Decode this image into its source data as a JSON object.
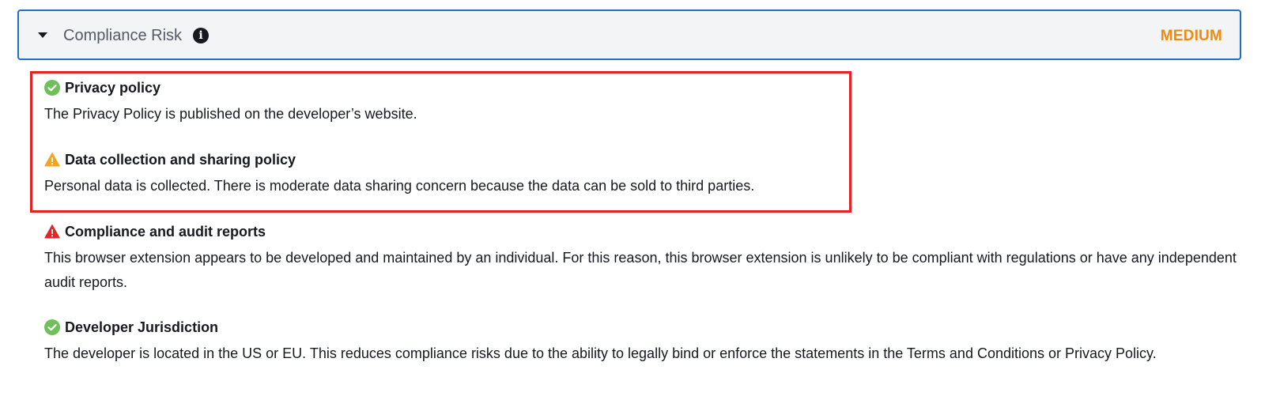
{
  "panel": {
    "title": "Compliance Risk",
    "info_icon_glyph": "i",
    "risk_level": "MEDIUM",
    "risk_color": "#ec8b14",
    "border_color": "#1f6fc5"
  },
  "highlight_color": "#e32222",
  "sections": [
    {
      "status": "ok",
      "icon": "check-circle-icon",
      "title": "Privacy policy",
      "description": "The Privacy Policy is published on the developer’s website."
    },
    {
      "status": "warning",
      "icon": "warning-triangle-icon",
      "title": "Data collection and sharing policy",
      "description": "Personal data is collected. There is moderate data sharing concern because the data can be sold to third parties."
    },
    {
      "status": "error",
      "icon": "error-triangle-icon",
      "title": "Compliance and audit reports",
      "description": "This browser extension appears to be developed and maintained by an individual. For this reason, this browser extension is unlikely to be compliant with regulations or have any independent audit reports."
    },
    {
      "status": "ok",
      "icon": "check-circle-icon",
      "title": "Developer Jurisdiction",
      "description": "The developer is located in the US or EU. This reduces compliance risks due to the ability to legally bind or enforce the statements in the Terms and Conditions or Privacy Policy."
    }
  ]
}
